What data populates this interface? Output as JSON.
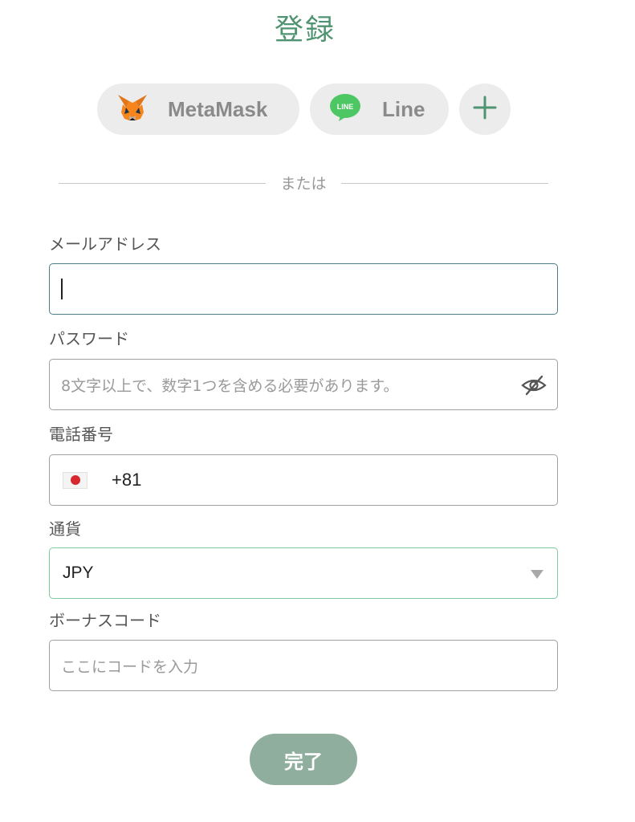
{
  "title": "登録",
  "social": {
    "metamask_label": "MetaMask",
    "line_label": "Line",
    "line_badge": "LINE"
  },
  "divider_text": "または",
  "form": {
    "email": {
      "label": "メールアドレス",
      "value": ""
    },
    "password": {
      "label": "パスワード",
      "placeholder": "8文字以上で、数字1つを含める必要があります。"
    },
    "phone": {
      "label": "電話番号",
      "dial_code": "+81",
      "country": "JP"
    },
    "currency": {
      "label": "通貨",
      "selected": "JPY"
    },
    "bonus_code": {
      "label": "ボーナスコード",
      "placeholder": "ここにコードを入力"
    }
  },
  "submit_label": "完了",
  "colors": {
    "brand_green": "#4f9471",
    "submit_bg": "#8fae9e",
    "pill_bg": "#ececec",
    "focus_border": "#4c7d86",
    "currency_border": "#7fc99e",
    "line_green": "#4cc764"
  },
  "icons": [
    "metamask-fox-icon",
    "line-icon",
    "plus-icon",
    "eye-slash-icon",
    "japan-flag-icon",
    "chevron-down-icon"
  ]
}
